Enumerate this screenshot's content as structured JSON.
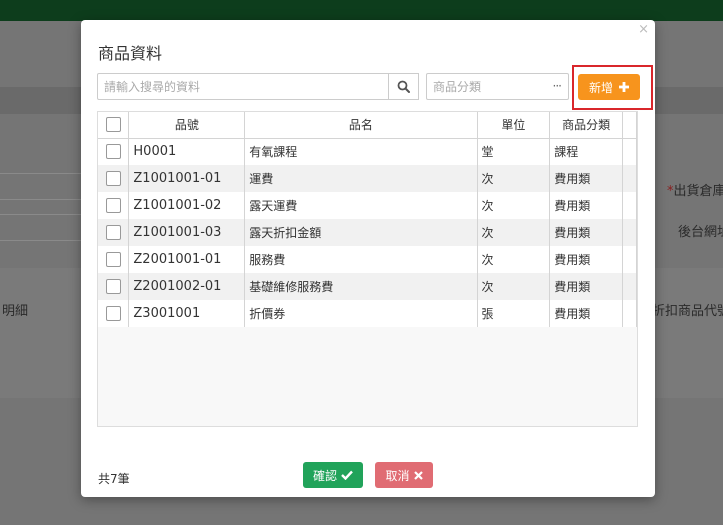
{
  "background": {
    "labels": {
      "detail": "明細",
      "required_mark": "*",
      "warehouse": "出貨倉庫",
      "backend": "後台網址",
      "discount_code": "折扣商品代號"
    }
  },
  "modal": {
    "title": "商品資料",
    "close_glyph": "×",
    "search": {
      "placeholder": "請輸入搜尋的資料",
      "value": ""
    },
    "category": {
      "placeholder": "商品分類",
      "more": "···"
    },
    "add_label": "新增",
    "table": {
      "headers": [
        "",
        "品號",
        "品名",
        "單位",
        "商品分類"
      ],
      "rows": [
        {
          "code": "H0001",
          "name": "有氧課程",
          "unit": "堂",
          "category": "課程"
        },
        {
          "code": "Z1001001-01",
          "name": "運費",
          "unit": "次",
          "category": "費用類"
        },
        {
          "code": "Z1001001-02",
          "name": "露天運費",
          "unit": "次",
          "category": "費用類"
        },
        {
          "code": "Z1001001-03",
          "name": "露天折扣金額",
          "unit": "次",
          "category": "費用類"
        },
        {
          "code": "Z2001001-01",
          "name": "服務費",
          "unit": "次",
          "category": "費用類"
        },
        {
          "code": "Z2001002-01",
          "name": "基礎維修服務費",
          "unit": "次",
          "category": "費用類"
        },
        {
          "code": "Z3001001",
          "name": "折價券",
          "unit": "張",
          "category": "費用類"
        }
      ]
    },
    "footer": {
      "count_text": "共7筆",
      "confirm_label": "確認",
      "cancel_label": "取消"
    }
  },
  "colors": {
    "topbar": "#0d3d1c",
    "add_button": "#f7941d",
    "confirm_button": "#21a35a",
    "cancel_button": "#e06c73",
    "highlight_border": "#d9262b"
  }
}
